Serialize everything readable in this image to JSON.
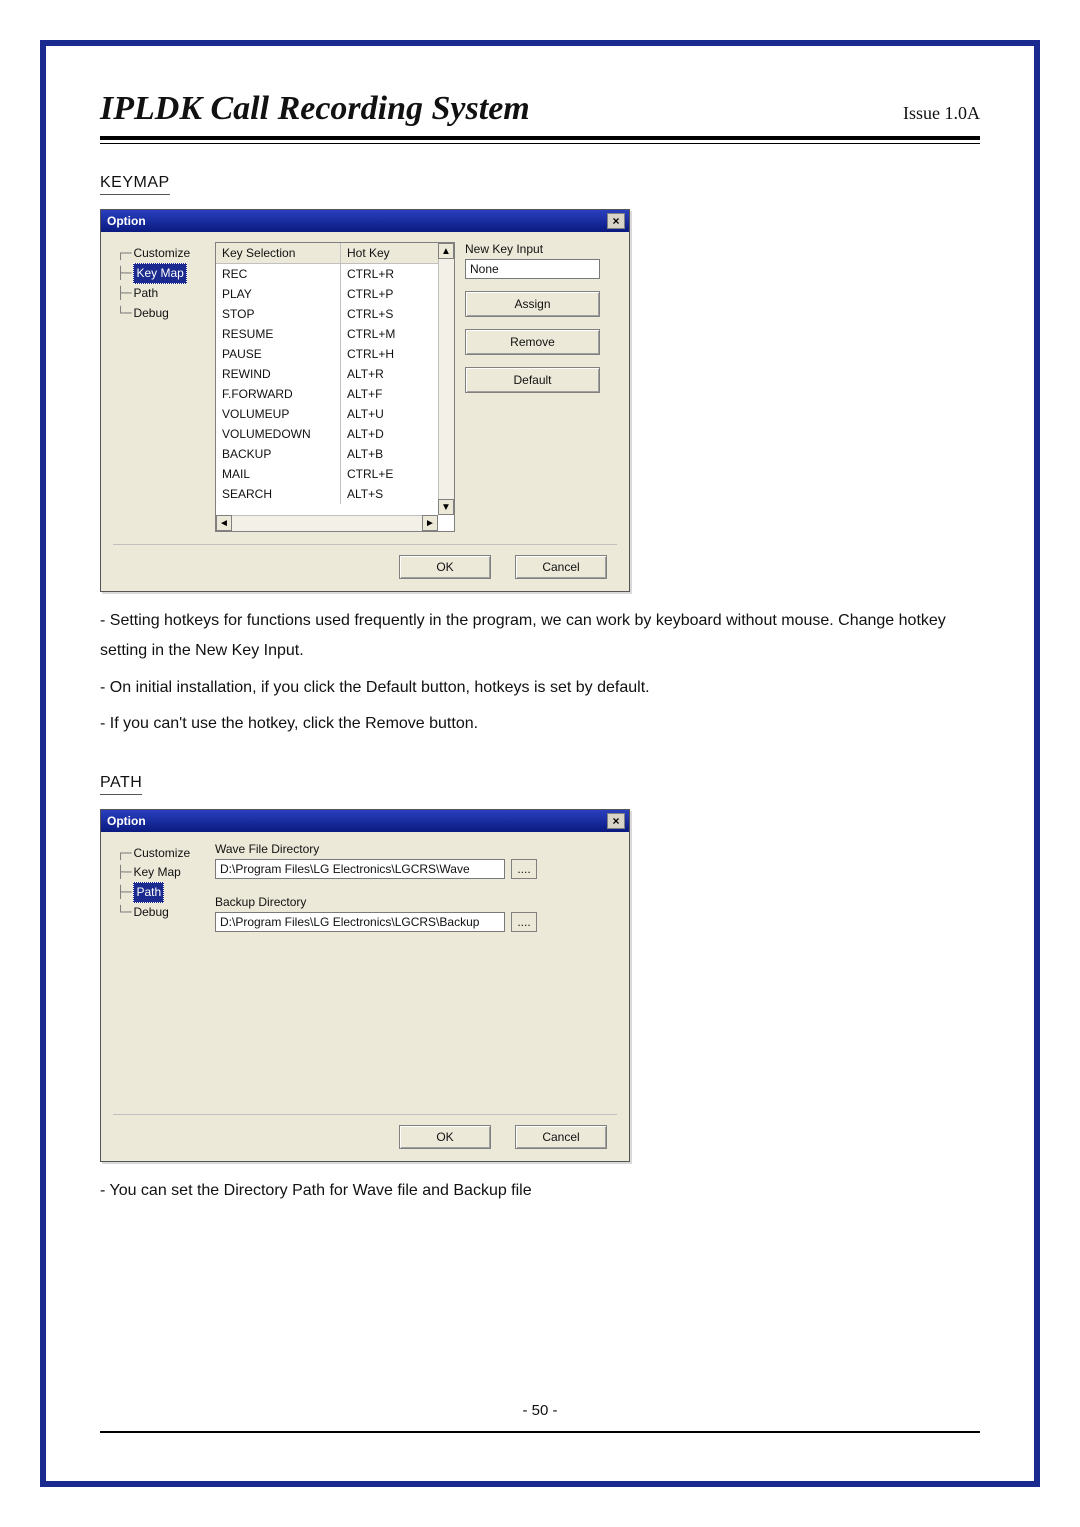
{
  "doc": {
    "title": "IPLDK Call Recording System",
    "issue": "Issue 1.0A",
    "page_number": "- 50 -"
  },
  "sections": {
    "keymap_label": "KEYMAP",
    "path_label": "PATH"
  },
  "keymap_dialog": {
    "title": "Option",
    "tree": [
      "Customize",
      "Key Map",
      "Path",
      "Debug"
    ],
    "tree_selected_index": 1,
    "list_headers": {
      "col1": "Key Selection",
      "col2": "Hot Key"
    },
    "rows": [
      {
        "key": "REC",
        "hot": "CTRL+R"
      },
      {
        "key": "PLAY",
        "hot": "CTRL+P"
      },
      {
        "key": "STOP",
        "hot": "CTRL+S"
      },
      {
        "key": "RESUME",
        "hot": "CTRL+M"
      },
      {
        "key": "PAUSE",
        "hot": "CTRL+H"
      },
      {
        "key": "REWIND",
        "hot": "ALT+R"
      },
      {
        "key": "F.FORWARD",
        "hot": "ALT+F"
      },
      {
        "key": "VOLUMEUP",
        "hot": "ALT+U"
      },
      {
        "key": "VOLUMEDOWN",
        "hot": "ALT+D"
      },
      {
        "key": "BACKUP",
        "hot": "ALT+B"
      },
      {
        "key": "MAIL",
        "hot": "CTRL+E"
      },
      {
        "key": "SEARCH",
        "hot": "ALT+S"
      }
    ],
    "side": {
      "label": "New Key Input",
      "value": "None",
      "assign": "Assign",
      "remove": "Remove",
      "default": "Default"
    },
    "footer": {
      "ok": "OK",
      "cancel": "Cancel"
    }
  },
  "keymap_text": {
    "p1": "- Setting hotkeys for functions used frequently in the program, we can work by keyboard without mouse. Change hotkey setting in the New Key Input.",
    "p2": "- On initial installation, if you click the Default button, hotkeys is set by default.",
    "p3": "- If you can't use the hotkey, click the Remove button."
  },
  "path_dialog": {
    "title": "Option",
    "tree": [
      "Customize",
      "Key Map",
      "Path",
      "Debug"
    ],
    "tree_selected_index": 2,
    "wave_label": "Wave File Directory",
    "wave_value": "D:\\Program Files\\LG Electronics\\LGCRS\\Wave",
    "backup_label": "Backup Directory",
    "backup_value": "D:\\Program Files\\LG Electronics\\LGCRS\\Backup",
    "browse": "....",
    "footer": {
      "ok": "OK",
      "cancel": "Cancel"
    }
  },
  "path_text": {
    "p1": "- You can set the Directory Path for Wave file and Backup file"
  }
}
